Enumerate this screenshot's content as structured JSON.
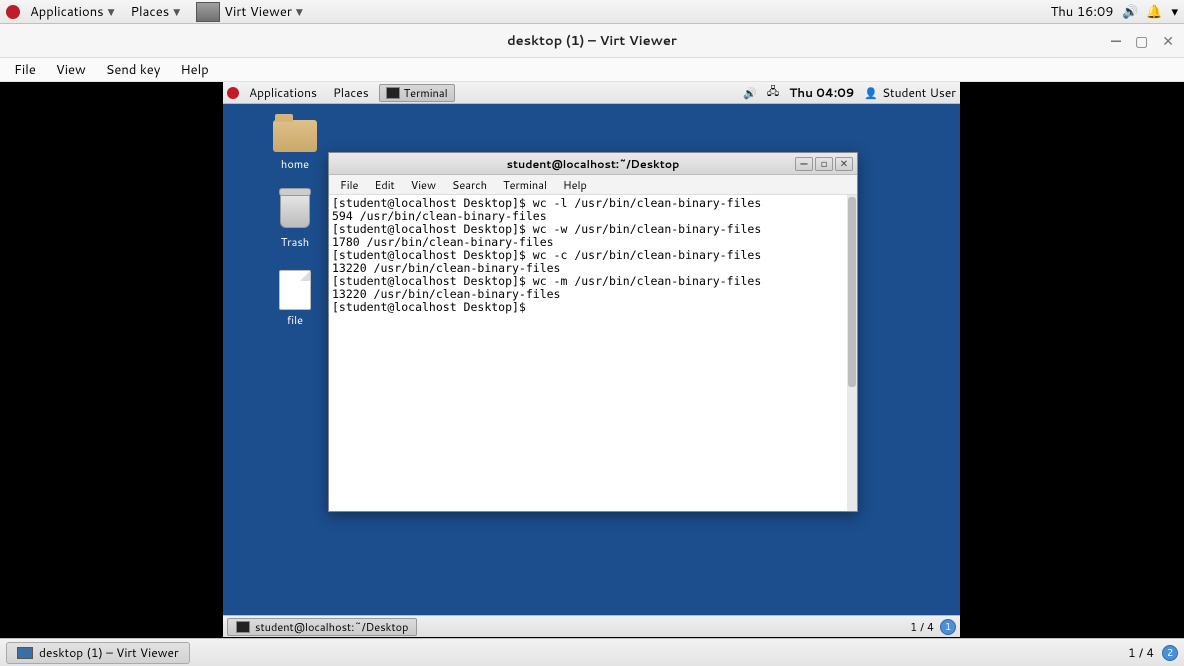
{
  "host_panel": {
    "applications": "Applications",
    "places": "Places",
    "app_button": "Virt Viewer",
    "clock": "Thu 16:09"
  },
  "virt_viewer": {
    "title": "desktop (1) – Virt Viewer",
    "menu": {
      "file": "File",
      "view": "View",
      "send_key": "Send key",
      "help": "Help"
    }
  },
  "guest_panel": {
    "applications": "Applications",
    "places": "Places",
    "task_terminal": "Terminal",
    "clock": "Thu 04:09",
    "user": "Student User"
  },
  "guest_desktop_icons": {
    "home": "home",
    "trash": "Trash",
    "file": "file"
  },
  "terminal": {
    "title": "student@localhost:~/Desktop",
    "menu": {
      "file": "File",
      "edit": "Edit",
      "view": "View",
      "search": "Search",
      "terminal": "Terminal",
      "help": "Help"
    },
    "lines": [
      "[student@localhost Desktop]$ wc -l /usr/bin/clean-binary-files",
      "594 /usr/bin/clean-binary-files",
      "[student@localhost Desktop]$ wc -w /usr/bin/clean-binary-files",
      "1780 /usr/bin/clean-binary-files",
      "[student@localhost Desktop]$ wc -c /usr/bin/clean-binary-files",
      "13220 /usr/bin/clean-binary-files",
      "[student@localhost Desktop]$ wc -m /usr/bin/clean-binary-files",
      "13220 /usr/bin/clean-binary-files",
      "[student@localhost Desktop]$ "
    ]
  },
  "guest_bottom": {
    "task": "student@localhost:~/Desktop",
    "workspace": "1 / 4",
    "badge": "1"
  },
  "host_bottom": {
    "task": "desktop (1) – Virt Viewer",
    "workspace": "1 / 4",
    "badge": "2"
  }
}
